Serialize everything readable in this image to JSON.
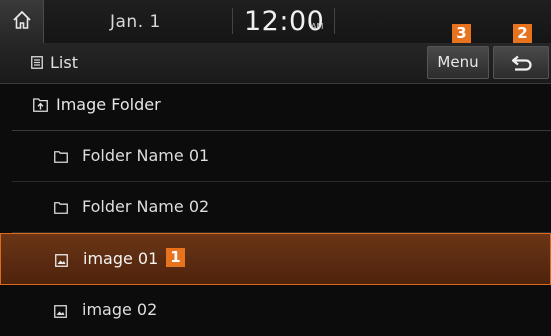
{
  "statusbar": {
    "home_icon": "home-icon",
    "date": "Jan.  1",
    "time": "12:00",
    "time_suffix": "AM"
  },
  "toolbar": {
    "list_label": "List",
    "menu_label": "Menu",
    "back_icon": "back-arrow-icon"
  },
  "badges": {
    "menu": "3",
    "back": "2",
    "selected_item": "1"
  },
  "folder_header": {
    "label": "Image Folder"
  },
  "items": [
    {
      "type": "folder",
      "icon": "folder-icon",
      "label": "Folder Name 01",
      "selected": false
    },
    {
      "type": "folder",
      "icon": "folder-icon",
      "label": "Folder Name 02",
      "selected": false
    },
    {
      "type": "image",
      "icon": "image-file-icon",
      "label": "image 01",
      "selected": true
    },
    {
      "type": "image",
      "icon": "image-file-icon",
      "label": "image 02",
      "selected": false
    }
  ],
  "colors": {
    "accent": "#e8731e",
    "selected_bg": "#5c2c10",
    "background": "#0c0c0c"
  }
}
